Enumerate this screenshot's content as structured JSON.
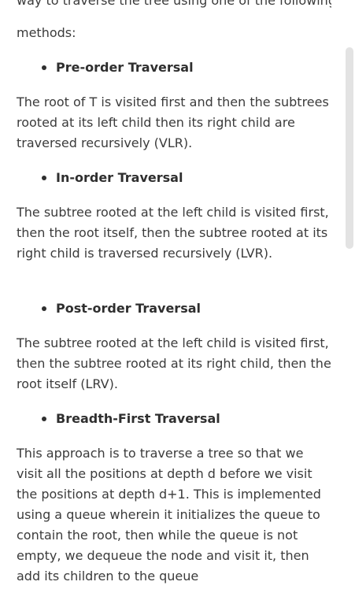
{
  "article": {
    "cut_line": "way to traverse the tree using one of the following",
    "intro": "methods:",
    "sections": [
      {
        "heading": "Pre-order Traversal",
        "body": "The root of T is visited first and then the subtrees rooted at its left child then its right child are traversed recursively (VLR)."
      },
      {
        "heading": "In-order Traversal",
        "body": "The subtree rooted at the left child is visited first, then the root itself, then the subtree rooted at its right child is traversed recursively (LVR)."
      },
      {
        "heading": "Post-order Traversal",
        "body": "The subtree rooted at the left child is visited first, then the subtree rooted at its right child, then the root itself (LRV)."
      },
      {
        "heading": "Breadth-First Traversal",
        "body": "This approach is to traverse a tree so that we visit all the positions at depth d before we visit the positions at depth d+1. This is implemented using a queue wherein it initializes the queue to contain the root, then while the queue is not empty, we dequeue the node and visit it, then add its children to the queue"
      }
    ]
  }
}
